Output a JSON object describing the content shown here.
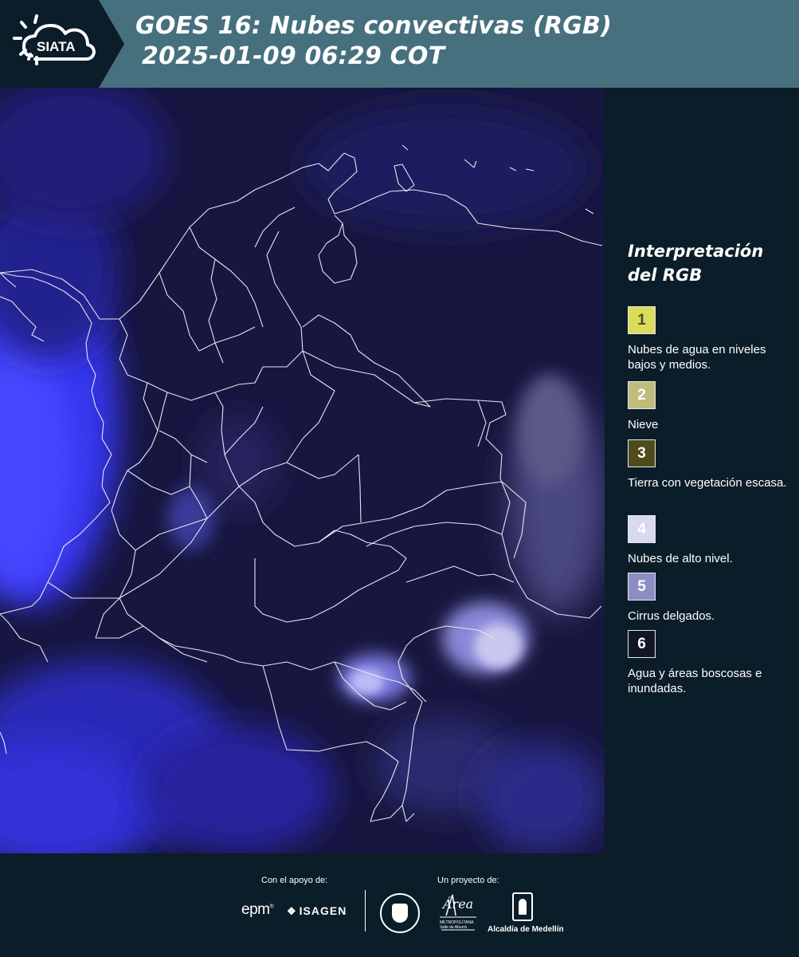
{
  "header": {
    "logo_text": "SIATA",
    "title_line1": "GOES 16: Nubes convectivas (RGB)",
    "title_line2": "2025-01-09 06:29 COT"
  },
  "map": {
    "type": "satellite-rgb-composite",
    "region": "Colombia",
    "background_color": "#17163f",
    "boundary_color": "#e6e6ef",
    "cloud_color": "#3a3ae8"
  },
  "legend": {
    "title_line1": "Interpretación",
    "title_line2": "del RGB",
    "items": [
      {
        "number": "1",
        "label": "Nubes de agua en niveles bajos y medios.",
        "color": "#dcdc5a",
        "text_color": "#4a4a2a"
      },
      {
        "number": "2",
        "label": "Nieve",
        "color": "#c1bb7e",
        "text_color": "#ffffff"
      },
      {
        "number": "3",
        "label": "Tierra con vegetación escasa.",
        "color": "#4e4b1c",
        "text_color": "#ffffff"
      },
      {
        "number": "4",
        "label": "Nubes de alto nivel.",
        "color": "#d9d8f2",
        "text_color": "#ffffff"
      },
      {
        "number": "5",
        "label": "Cirrus delgados.",
        "color": "#8d8dc6",
        "text_color": "#ffffff"
      },
      {
        "number": "6",
        "label": "Agua y áreas boscosas e inundadas.",
        "color": "#111526",
        "text_color": "#ffffff"
      }
    ]
  },
  "footer": {
    "support_label": "Con el apoyo de:",
    "project_label": "Un proyecto de:",
    "sponsor1": "epm",
    "sponsor2": "ISAGEN",
    "partner_area": "Área",
    "partner_area_sub1": "METROPOLITANA",
    "partner_area_sub2": "Valle de Aburrá",
    "partner_alcaldia": "Alcaldía de Medellín"
  }
}
